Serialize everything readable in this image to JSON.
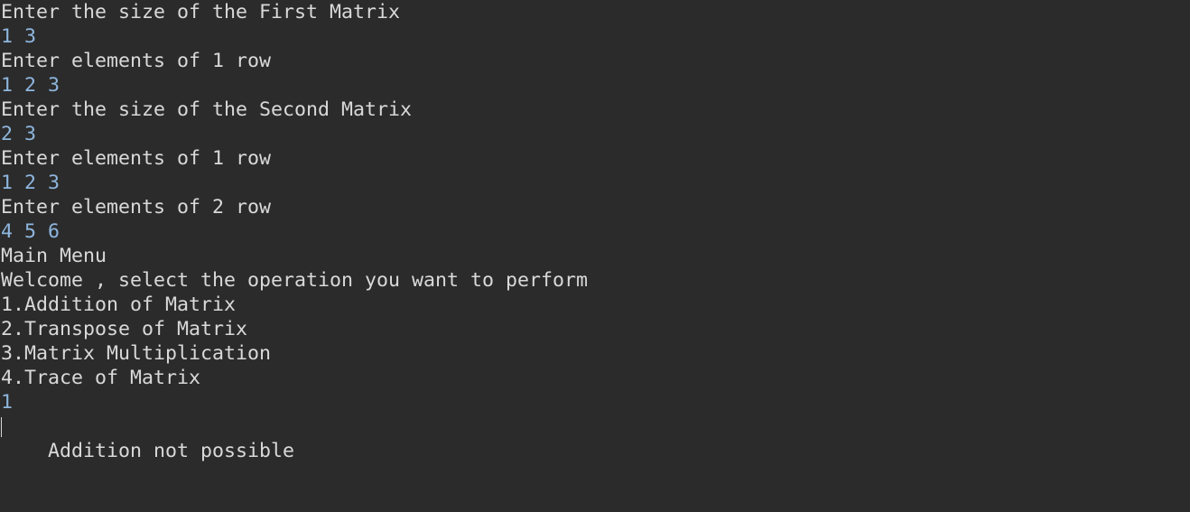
{
  "console": {
    "lines": [
      {
        "kind": "output",
        "text": "Enter the size of the First Matrix"
      },
      {
        "kind": "input",
        "text": "1 3"
      },
      {
        "kind": "output",
        "text": "Enter elements of 1 row"
      },
      {
        "kind": "input",
        "text": "1 2 3"
      },
      {
        "kind": "output",
        "text": "Enter the size of the Second Matrix"
      },
      {
        "kind": "input",
        "text": "2 3"
      },
      {
        "kind": "output",
        "text": "Enter elements of 1 row"
      },
      {
        "kind": "input",
        "text": "1 2 3"
      },
      {
        "kind": "output",
        "text": "Enter elements of 2 row"
      },
      {
        "kind": "input",
        "text": "4 5 6"
      },
      {
        "kind": "output",
        "text": "Main Menu"
      },
      {
        "kind": "output",
        "text": "Welcome , select the operation you want to perform"
      },
      {
        "kind": "output",
        "text": "1.Addition of Matrix"
      },
      {
        "kind": "output",
        "text": "2.Transpose of Matrix"
      },
      {
        "kind": "output",
        "text": "3.Matrix Multiplication"
      },
      {
        "kind": "output",
        "text": "4.Trace of Matrix"
      },
      {
        "kind": "input",
        "text": "1"
      },
      {
        "kind": "output",
        "text": "Addition not possible"
      }
    ]
  },
  "colors": {
    "background": "#2b2b2b",
    "output_text": "#d9d9d9",
    "input_text": "#8eb6de"
  }
}
